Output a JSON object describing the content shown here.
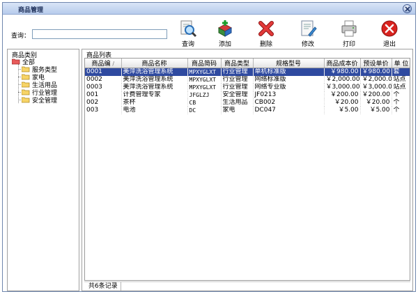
{
  "window": {
    "title": "商品管理"
  },
  "search": {
    "label": "查询：",
    "value": "",
    "placeholder": ""
  },
  "toolbar": {
    "query_label": "查询",
    "add_label": "添加",
    "delete_label": "删除",
    "edit_label": "修改",
    "print_label": "打印",
    "exit_label": "退出"
  },
  "category_panel": {
    "caption": "商品类别",
    "root": "全部",
    "items": [
      "服务类型",
      "家电",
      "生活用品",
      "行业管理",
      "安全管理"
    ]
  },
  "list_panel": {
    "caption": "商品列表",
    "columns": [
      "商品编",
      "商品名称",
      "商品简码",
      "商品类型",
      "规格型号",
      "商品成本价",
      "预设单价",
      "单 位"
    ],
    "rows": [
      [
        "0001",
        "美萍洗浴管理系统",
        "MPXYGLXT",
        "行业管理",
        "单机标准版",
        "￥980.00",
        "￥980.00",
        "套"
      ],
      [
        "0002",
        "美萍洗浴管理系统",
        "MPXYGLXT",
        "行业管理",
        "网络标准版",
        "￥2,000.00",
        "￥2,000.00",
        "站点"
      ],
      [
        "0003",
        "美萍洗浴管理系统",
        "MPXYGLXT",
        "行业管理",
        "网络专业版",
        "￥3,000.00",
        "￥3,000.00",
        "站点"
      ],
      [
        "001",
        "计费管理专家",
        "JFGLZJ",
        "安全管理",
        "JF0213",
        "￥200.00",
        "￥200.00",
        "个"
      ],
      [
        "002",
        "茶杯",
        "CB",
        "生活用品",
        "CB002",
        "￥20.00",
        "￥20.00",
        "个"
      ],
      [
        "003",
        "电池",
        "DC",
        "家电",
        "DC047",
        "￥5.00",
        "￥5.00",
        "个"
      ]
    ],
    "selected_row": 0
  },
  "status": {
    "record_count": "共6条记录"
  },
  "colors": {
    "selection": "#2f4aa0",
    "title_bar": "#c4d5f0",
    "border": "#6f86ad"
  }
}
